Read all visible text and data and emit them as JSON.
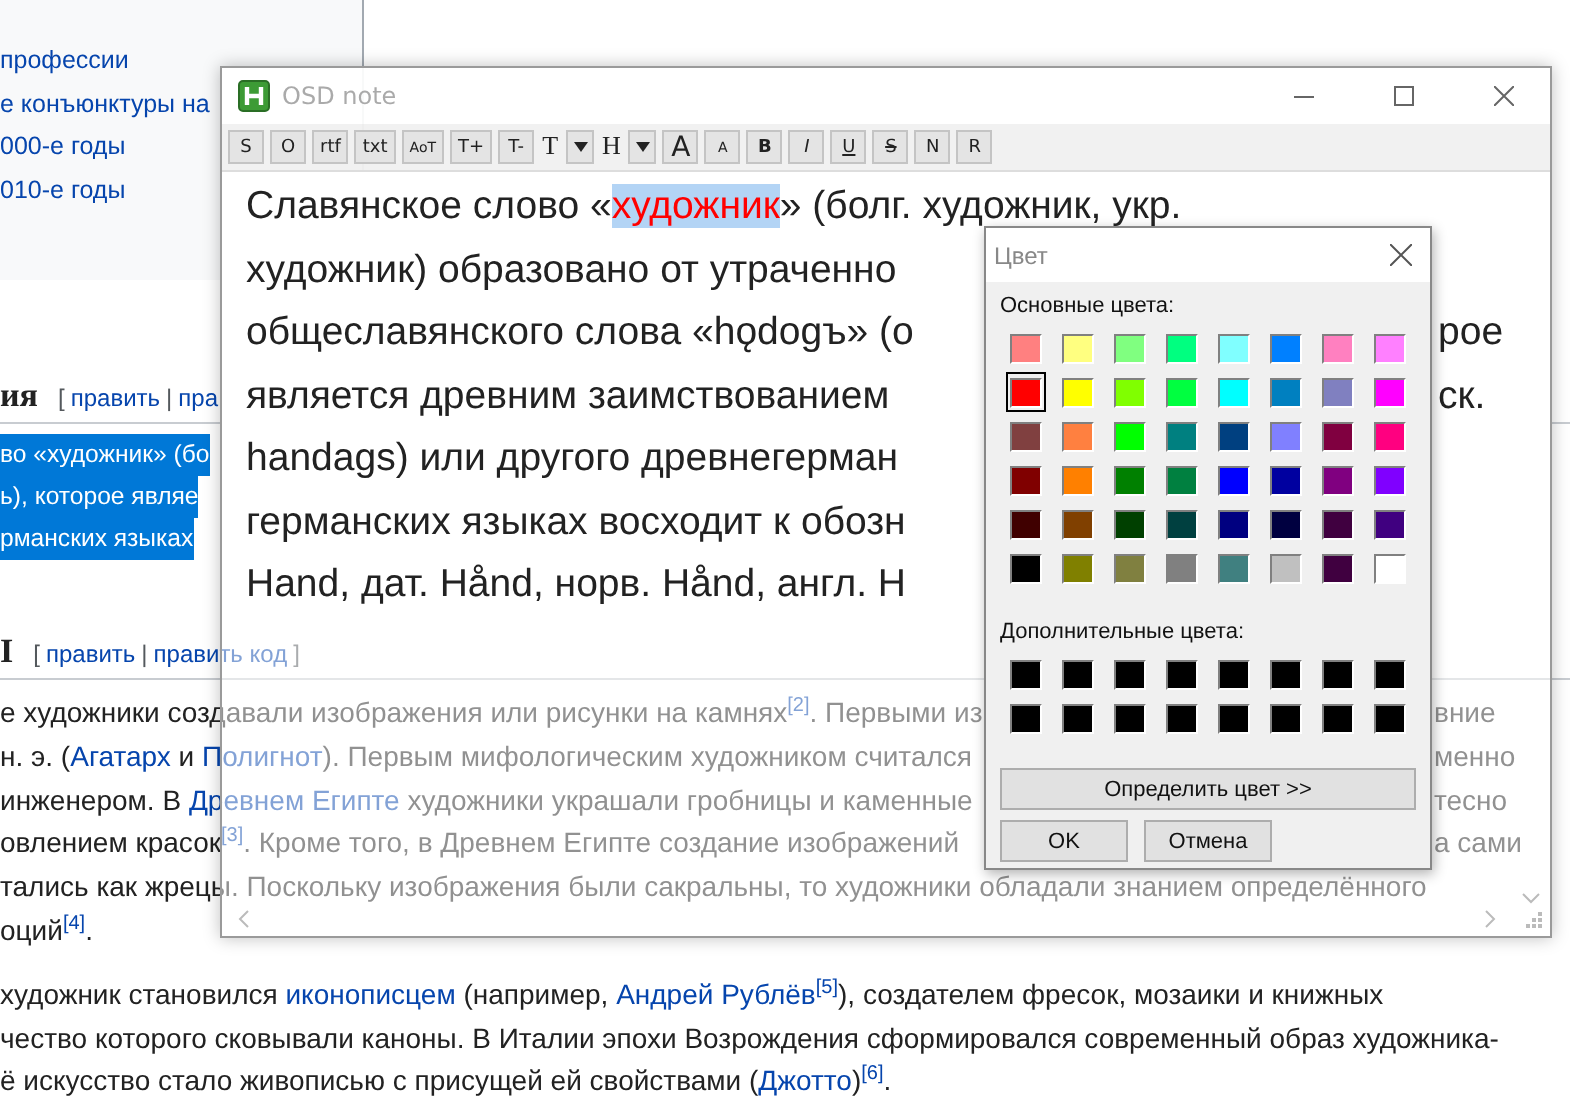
{
  "page": {
    "toc": [
      "профессии",
      "е конъюнктуры на",
      "000-е годы",
      "010-е годы"
    ],
    "sections": [
      {
        "heading": "ия",
        "edit": [
          {
            "kind": "text",
            "text": "["
          },
          {
            "kind": "link",
            "text": "править"
          },
          {
            "kind": "text",
            "text": "|"
          },
          {
            "kind": "link",
            "text": "пра"
          }
        ],
        "lines": [
          {
            "selected": true,
            "segments": [
              {
                "kind": "text",
                "text": "во «художник» (бо"
              }
            ]
          },
          {
            "selected": true,
            "segments": [
              {
                "kind": "text",
                "text": "ь), которое являе"
              }
            ]
          },
          {
            "selected": true,
            "segments": [
              {
                "kind": "text",
                "text": "рманских языках"
              }
            ]
          }
        ]
      },
      {
        "heading": "I",
        "edit": [
          {
            "kind": "text",
            "text": "["
          },
          {
            "kind": "link",
            "text": "править"
          },
          {
            "kind": "text",
            "text": "|"
          },
          {
            "kind": "link",
            "text": "править код"
          },
          {
            "kind": "text",
            "text": "]"
          }
        ],
        "lines": [
          {
            "selected": false,
            "segments": [
              {
                "kind": "text",
                "text": "е художники создавали изображения или рисунки на камнях"
              },
              {
                "kind": "ref",
                "text": "[2]"
              },
              {
                "kind": "text",
                "text": ". Первыми из"
              }
            ],
            "right": "вние"
          },
          {
            "selected": false,
            "segments": [
              {
                "kind": "text",
                "text": "н. э. ("
              },
              {
                "kind": "link",
                "text": "Агатарх"
              },
              {
                "kind": "text",
                "text": " и "
              },
              {
                "kind": "link",
                "text": "Полигнот"
              },
              {
                "kind": "text",
                "text": "). Первым мифологическим художником считался"
              }
            ],
            "right": "менно"
          },
          {
            "selected": false,
            "segments": [
              {
                "kind": "text",
                "text": "инженером. В "
              },
              {
                "kind": "link",
                "text": "Древнем Египте"
              },
              {
                "kind": "text",
                "text": " художники украшали гробницы и каменные"
              }
            ],
            "right": "тесно"
          },
          {
            "selected": false,
            "segments": [
              {
                "kind": "text",
                "text": "овлением красок"
              },
              {
                "kind": "ref",
                "text": "[3]"
              },
              {
                "kind": "text",
                "text": ". Кроме того, в Древнем Египте создание изображений"
              }
            ],
            "right": "а сами"
          },
          {
            "selected": false,
            "segments": [
              {
                "kind": "text",
                "text": "тались как жрецы. Поскольку изображения были сакральны, то художники обладали знанием определённого"
              }
            ]
          },
          {
            "selected": false,
            "segments": [
              {
                "kind": "text",
                "text": "оций"
              },
              {
                "kind": "ref",
                "text": "[4]"
              },
              {
                "kind": "text",
                "text": "."
              }
            ]
          }
        ]
      }
    ],
    "paragraph": [
      {
        "selected": false,
        "segments": [
          {
            "kind": "text",
            "text": "художник становился "
          },
          {
            "kind": "link",
            "text": "иконописцем"
          },
          {
            "kind": "text",
            "text": " (например, "
          },
          {
            "kind": "link",
            "text": "Андрей Рублёв"
          },
          {
            "kind": "ref",
            "text": "[5]"
          },
          {
            "kind": "text",
            "text": "), создателем фресок, мозаики и книжных"
          }
        ]
      },
      {
        "selected": false,
        "segments": [
          {
            "kind": "text",
            "text": "чество которого сковывали каноны. В Италии эпохи Возрождения сформировался современный образ художника-"
          }
        ]
      },
      {
        "selected": false,
        "segments": [
          {
            "kind": "text",
            "text": "ё искусство стало живописью с присущей ей свойствами ("
          },
          {
            "kind": "link",
            "text": "Джотто"
          },
          {
            "kind": "text",
            "text": ")"
          },
          {
            "kind": "ref",
            "text": "[6]"
          },
          {
            "kind": "text",
            "text": "."
          }
        ]
      }
    ]
  },
  "osd_window": {
    "title": "OSD note",
    "toolbar": [
      {
        "kind": "plain",
        "label": "S"
      },
      {
        "kind": "plain",
        "label": "O"
      },
      {
        "kind": "plain",
        "label": "rtf"
      },
      {
        "kind": "plain",
        "label": "txt"
      },
      {
        "kind": "small",
        "label": "AoT"
      },
      {
        "kind": "plain",
        "label": "T+"
      },
      {
        "kind": "plain",
        "label": "T-"
      },
      {
        "kind": "glyph",
        "label": "T"
      },
      {
        "kind": "dropdown"
      },
      {
        "kind": "glyph",
        "label": "H"
      },
      {
        "kind": "dropdown"
      },
      {
        "kind": "large",
        "label": "A"
      },
      {
        "kind": "small",
        "label": "A"
      },
      {
        "kind": "bold",
        "label": "B"
      },
      {
        "kind": "italic",
        "label": "I"
      },
      {
        "kind": "underline",
        "label": "U"
      },
      {
        "kind": "strike",
        "label": "S"
      },
      {
        "kind": "plain",
        "label": "N"
      },
      {
        "kind": "plain",
        "label": "R"
      }
    ],
    "lines": [
      {
        "segments": [
          {
            "text": "Славянское слово «",
            "selected": false
          },
          {
            "text": "художник",
            "selected": true,
            "color": "#ff0000"
          },
          {
            "text": "» (болг. художник, укр.",
            "selected": false
          }
        ]
      },
      {
        "segments": [
          {
            "text": "художник) образовано от утраченно",
            "selected": false
          }
        ]
      },
      {
        "segments": [
          {
            "text": "общеславянского слова «hǫdogъ» (о",
            "selected": false
          }
        ],
        "right": "рое"
      },
      {
        "segments": [
          {
            "text": "является древним заимствованием",
            "selected": false
          }
        ],
        "right": "ск."
      },
      {
        "segments": [
          {
            "text": "handags) или другого древнегерман",
            "selected": false
          }
        ]
      },
      {
        "segments": [
          {
            "text": "германских языках восходит к обозн",
            "selected": false
          }
        ]
      },
      {
        "segments": [
          {
            "text": "Hand, дат. Hånd, норв. Hånd, англ. H",
            "selected": false
          }
        ]
      }
    ]
  },
  "color_dialog": {
    "title": "Цвет",
    "basic_label": "Основные цвета:",
    "basic_colors": [
      {
        "color": "#ff8080",
        "selected": false
      },
      {
        "color": "#ffff80",
        "selected": false
      },
      {
        "color": "#80ff80",
        "selected": false
      },
      {
        "color": "#00ff80",
        "selected": false
      },
      {
        "color": "#80ffff",
        "selected": false
      },
      {
        "color": "#0080ff",
        "selected": false
      },
      {
        "color": "#ff80c0",
        "selected": false
      },
      {
        "color": "#ff80ff",
        "selected": false
      },
      {
        "color": "#ff0000",
        "selected": true
      },
      {
        "color": "#ffff00",
        "selected": false
      },
      {
        "color": "#80ff00",
        "selected": false
      },
      {
        "color": "#00ff40",
        "selected": false
      },
      {
        "color": "#00ffff",
        "selected": false
      },
      {
        "color": "#0080c0",
        "selected": false
      },
      {
        "color": "#8080c0",
        "selected": false
      },
      {
        "color": "#ff00ff",
        "selected": false
      },
      {
        "color": "#804040",
        "selected": false
      },
      {
        "color": "#ff8040",
        "selected": false
      },
      {
        "color": "#00ff00",
        "selected": false
      },
      {
        "color": "#008080",
        "selected": false
      },
      {
        "color": "#004080",
        "selected": false
      },
      {
        "color": "#8080ff",
        "selected": false
      },
      {
        "color": "#800040",
        "selected": false
      },
      {
        "color": "#ff0080",
        "selected": false
      },
      {
        "color": "#800000",
        "selected": false
      },
      {
        "color": "#ff8000",
        "selected": false
      },
      {
        "color": "#008000",
        "selected": false
      },
      {
        "color": "#008040",
        "selected": false
      },
      {
        "color": "#0000ff",
        "selected": false
      },
      {
        "color": "#0000a0",
        "selected": false
      },
      {
        "color": "#800080",
        "selected": false
      },
      {
        "color": "#8000ff",
        "selected": false
      },
      {
        "color": "#400000",
        "selected": false
      },
      {
        "color": "#804000",
        "selected": false
      },
      {
        "color": "#004000",
        "selected": false
      },
      {
        "color": "#004040",
        "selected": false
      },
      {
        "color": "#000080",
        "selected": false
      },
      {
        "color": "#000040",
        "selected": false
      },
      {
        "color": "#400040",
        "selected": false
      },
      {
        "color": "#400080",
        "selected": false
      },
      {
        "color": "#000000",
        "selected": false
      },
      {
        "color": "#808000",
        "selected": false
      },
      {
        "color": "#808040",
        "selected": false
      },
      {
        "color": "#808080",
        "selected": false
      },
      {
        "color": "#408080",
        "selected": false
      },
      {
        "color": "#c0c0c0",
        "selected": false
      },
      {
        "color": "#400040",
        "selected": false
      },
      {
        "color": "#ffffff",
        "selected": false
      }
    ],
    "custom_label": "Дополнительные цвета:",
    "custom_colors": [
      {
        "color": "#000000"
      },
      {
        "color": "#000000"
      },
      {
        "color": "#000000"
      },
      {
        "color": "#000000"
      },
      {
        "color": "#000000"
      },
      {
        "color": "#000000"
      },
      {
        "color": "#000000"
      },
      {
        "color": "#000000"
      },
      {
        "color": "#000000"
      },
      {
        "color": "#000000"
      },
      {
        "color": "#000000"
      },
      {
        "color": "#000000"
      },
      {
        "color": "#000000"
      },
      {
        "color": "#000000"
      },
      {
        "color": "#000000"
      },
      {
        "color": "#000000"
      }
    ],
    "define_button": "Определить цвет >>",
    "ok_button": "OK",
    "cancel_button": "Отмена"
  }
}
